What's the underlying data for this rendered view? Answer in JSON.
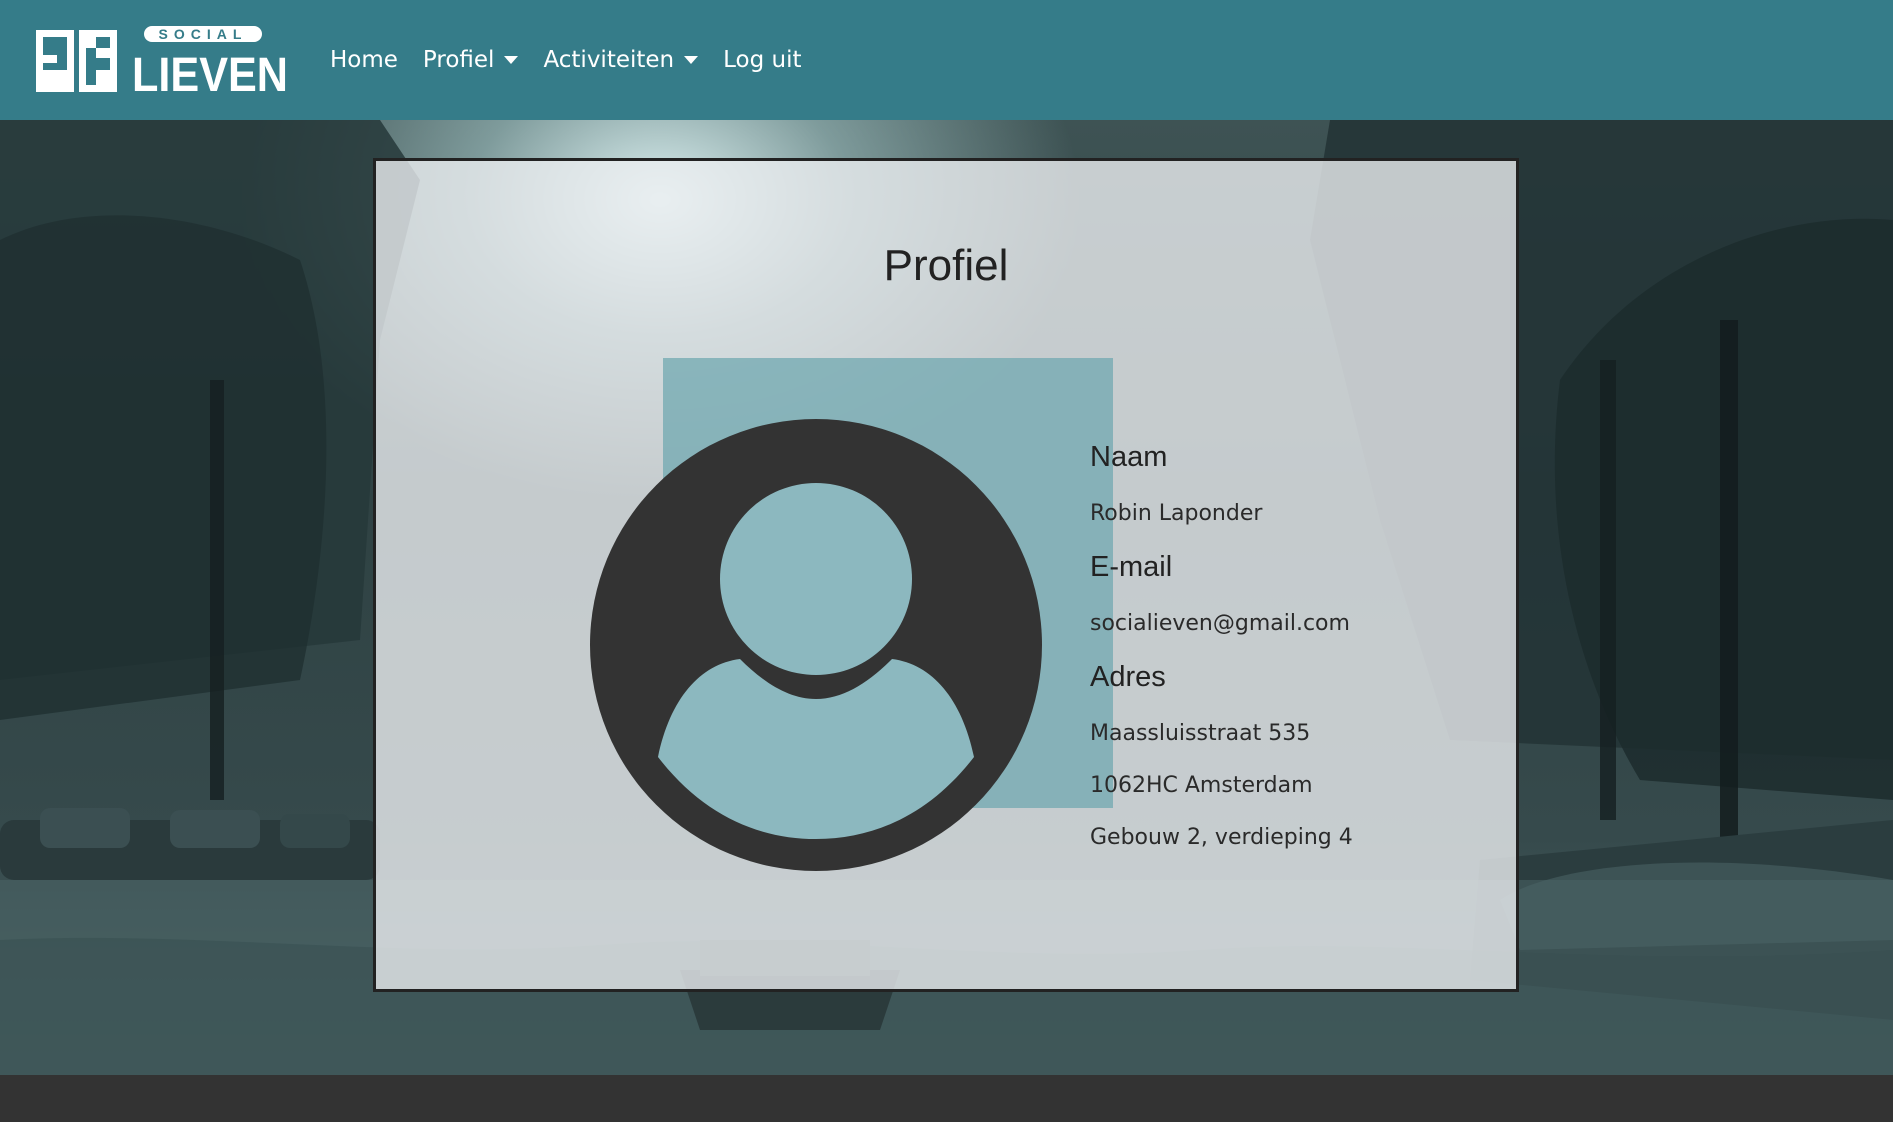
{
  "navbar": {
    "logo_text_top": "SOCIAL",
    "logo_text_main": "LIEVEN",
    "items": [
      {
        "label": "Home",
        "dropdown": false
      },
      {
        "label": "Profiel",
        "dropdown": true
      },
      {
        "label": "Activiteiten",
        "dropdown": true
      },
      {
        "label": "Log uit",
        "dropdown": false
      }
    ]
  },
  "colors": {
    "navbar": "#357c89",
    "avatar_bg": "#70a8b0",
    "avatar_icon": "#333333",
    "footer": "#333333"
  },
  "profile": {
    "title": "Profiel",
    "avatar_icon": "user-circle-icon",
    "fields": {
      "name_label": "Naam",
      "name_value": "Robin Laponder",
      "email_label": "E-mail",
      "email_value": "socialieven@gmail.com",
      "address_label": "Adres",
      "address_line1": "Maassluisstraat 535",
      "address_line2": "1062HC Amsterdam",
      "address_line3": "Gebouw 2, verdieping 4"
    }
  }
}
